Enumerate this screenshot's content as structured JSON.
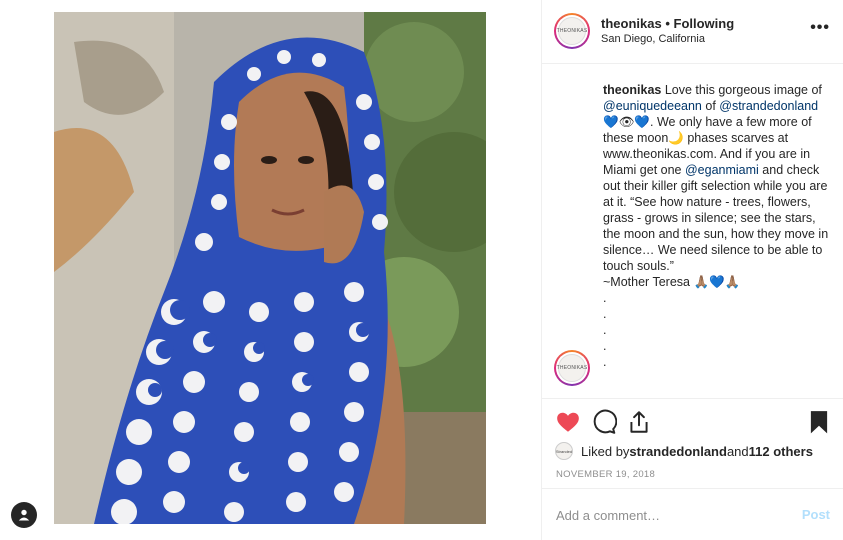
{
  "post": {
    "author": {
      "username": "theonikas",
      "separator": "•",
      "follow_status": "Following",
      "location": "San Diego, California",
      "avatar_text": "THEONIKAS"
    },
    "more_label": "•••",
    "caption": {
      "username": "theonikas",
      "part1": " Love this gorgeous image of ",
      "mention1": "@euniquedeeann",
      "part2": " of ",
      "mention2": "@strandedonland",
      "part3": " 💙👁💙. We only have a few more of these moon🌙 phases scarves at www.theonikas.com. And if you are in Miami get one ",
      "mention3": "@eganmiami",
      "part4": " and check out their killer gift selection while you are at it. “See how nature - trees, flowers, grass - grows in silence; see the stars, the moon and the sun, how they move in silence… We need silence to be able to touch souls.”\n~Mother Teresa 🙏🏽💙🙏🏽\n.\n.\n.\n.\n."
    },
    "likes": {
      "liked_by_prefix": "Liked by ",
      "liked_by_user": "strandedonland",
      "and": " and ",
      "others": "112 others",
      "avatar_text": "Stranded"
    },
    "date": "NOVEMBER 19, 2018",
    "comment": {
      "placeholder": "Add a comment…",
      "value": "",
      "post_label": "Post"
    },
    "icons": {
      "like": "heart-filled-icon",
      "comment": "comment-bubble-icon",
      "share": "share-icon",
      "save": "bookmark-filled-icon",
      "tag": "user-tag-icon",
      "more": "more-options-icon"
    },
    "colors": {
      "like_red": "#ed4956",
      "mention_blue": "#003569",
      "post_button_disabled": "#b2dffc",
      "scarf_blue": "#2d4fb8"
    }
  }
}
